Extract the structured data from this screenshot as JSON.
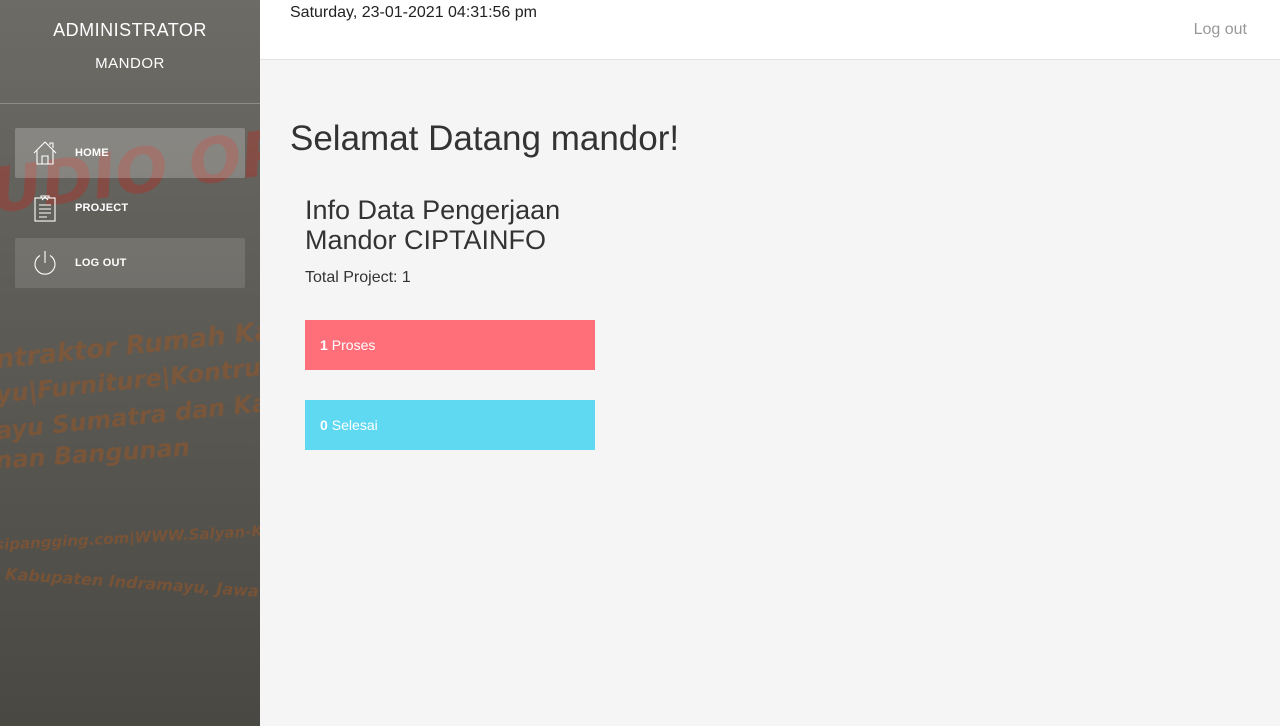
{
  "sidebar": {
    "role": "ADMINISTRATOR",
    "username": "MANDOR",
    "items": [
      {
        "label": "HOME",
        "icon": "home-icon"
      },
      {
        "label": "PROJECT",
        "icon": "clipboard-icon"
      },
      {
        "label": "LOG OUT",
        "icon": "power-icon"
      }
    ]
  },
  "header": {
    "datetime": "Saturday, 23-01-2021 04:31:56 pm",
    "logout": "Log out"
  },
  "main": {
    "welcome": "Selamat Datang mandor!",
    "info_title_line1": "Info Data Pengerjaan",
    "info_title_line2": "Mandor CIPTAINFO",
    "total_label": "Total Project: 1",
    "stats": {
      "proses": {
        "count": "1",
        "label": "Proses",
        "color": "#ff6f7a"
      },
      "selesai": {
        "count": "0",
        "label": "Selesai",
        "color": "#5fd8f1"
      }
    }
  }
}
